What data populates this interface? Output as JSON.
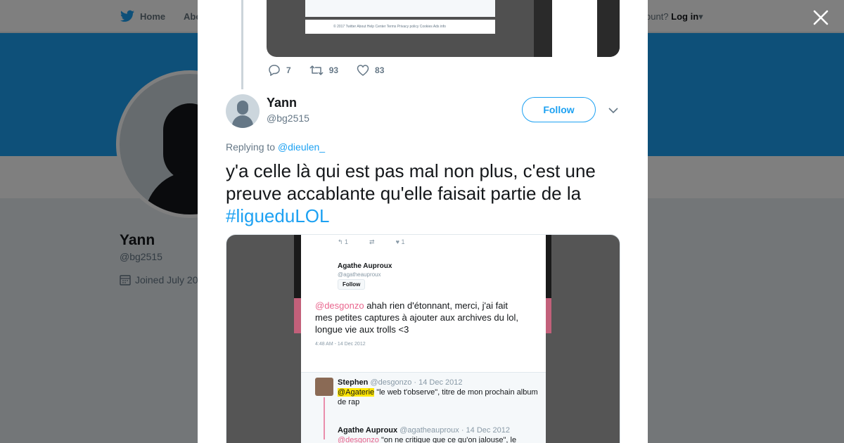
{
  "topnav": {
    "home_label": "Home",
    "about_label": "Abo",
    "account_text": "ccount?",
    "login_label": "Log in"
  },
  "profile": {
    "name": "Yann",
    "handle": "@bg2515",
    "joined": "Joined July 20"
  },
  "previous_tweet": {
    "media_footer": "© 2017 Twitter   About   Help Center   Terms   Privacy policy   Cookies   Ads info",
    "replies": "7",
    "retweets": "93",
    "likes": "83"
  },
  "tweet": {
    "author_name": "Yann",
    "author_handle": "@bg2515",
    "follow_label": "Follow",
    "replying_prefix": "Replying to",
    "replying_to": "@dieulen_",
    "text": "y'a celle là qui est pas mal non plus, c'est une preuve accablante qu'elle faisait partie de la",
    "hashtag": "#ligueduLOL"
  },
  "embedded_screenshot": {
    "icons_row": [
      "↰ 1",
      "⇄",
      "♥ 1"
    ],
    "author_name": "Agathe Auproux",
    "author_handle": "@agatheauproux",
    "follow_label": "Follow",
    "mention": "@desgonzo",
    "text": "ahah rien d'étonnant, merci, j'ai fait mes petites captures à ajouter aux archives du lol, longue vie aux trolls <3",
    "timestamp": "4:48 AM - 14 Dec 2012",
    "reply1_name": "Stephen",
    "reply1_meta": "@desgonzo · 14 Dec 2012",
    "reply1_mention": "@Agaterie",
    "reply1_text": "\"le web t'observe\", titre de mon prochain album de rap",
    "reply2_name": "Agathe Auproux",
    "reply2_meta": "@agatheauproux · 14 Dec 2012",
    "reply2_mention": "@desgonzo",
    "reply2_text": "\"on ne critique que ce qu'on jalouse\",  le"
  },
  "colors": {
    "brand_blue": "#1da1f2",
    "text_dark": "#14171a",
    "text_muted": "#657786"
  },
  "icons": [
    "twitter-bird-icon",
    "calendar-icon",
    "close-icon",
    "reply-icon",
    "retweet-icon",
    "like-icon",
    "chevron-down-icon"
  ]
}
